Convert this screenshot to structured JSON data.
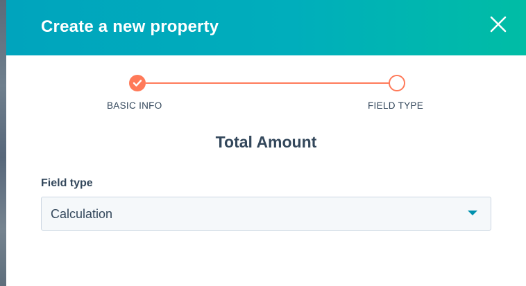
{
  "dialog": {
    "title": "Create a new property",
    "close_icon": "close-icon"
  },
  "stepper": {
    "steps": [
      {
        "label": "BASIC INFO",
        "status": "complete",
        "icon": "check-icon"
      },
      {
        "label": "FIELD TYPE",
        "status": "current"
      }
    ],
    "accent_color": "#ff7a59"
  },
  "property": {
    "name": "Total Amount"
  },
  "form": {
    "field_type_label": "Field type",
    "field_type_value": "Calculation",
    "caret_icon": "caret-down-icon"
  },
  "colors": {
    "header_start": "#00a4bd",
    "header_end": "#00bda5",
    "text": "#33475b",
    "select_bg": "#f5f8fa",
    "caret": "#0091ae"
  }
}
